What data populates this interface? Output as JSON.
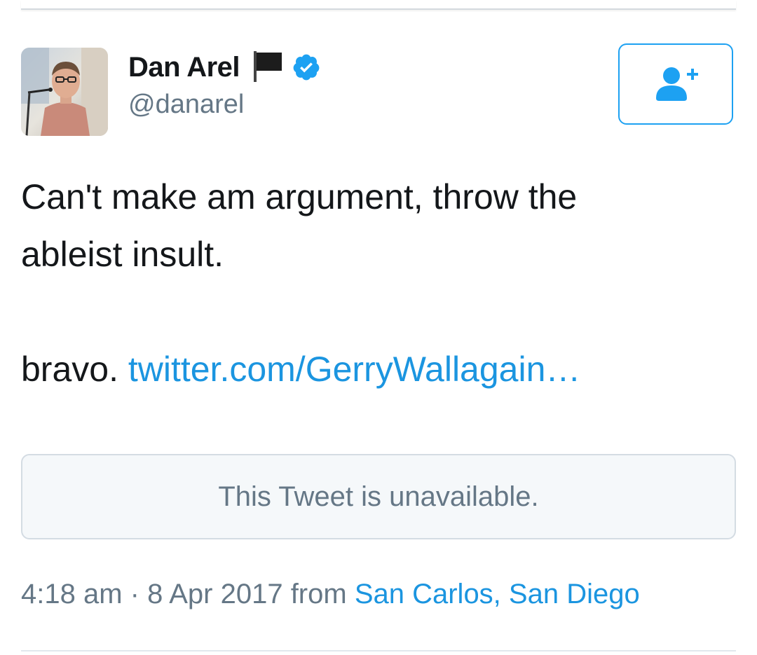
{
  "author": {
    "display_name": "Dan Arel",
    "handle": "@danarel",
    "avatar_icon": "user-avatar-photo",
    "flag_icon": "black-flag-icon",
    "verified_icon": "verified-badge-icon"
  },
  "follow_button": {
    "icon": "follow-user-plus-icon"
  },
  "tweet": {
    "line1": "Can't make am argument, throw the",
    "line2": "ableist insult.",
    "line3": "",
    "line4_prefix": "bravo. ",
    "link_text": "twitter.com/GerryWallagain…"
  },
  "quoted_tweet": {
    "message": "This Tweet is unavailable."
  },
  "meta": {
    "time": "4:18 am",
    "separator": " · ",
    "date": "8 Apr 2017",
    "from_label": " from ",
    "location": "San Carlos, San Diego"
  },
  "colors": {
    "link": "#1b95e0",
    "verified": "#1da1f2",
    "secondary_text": "#657786",
    "primary_text": "#14171a"
  }
}
